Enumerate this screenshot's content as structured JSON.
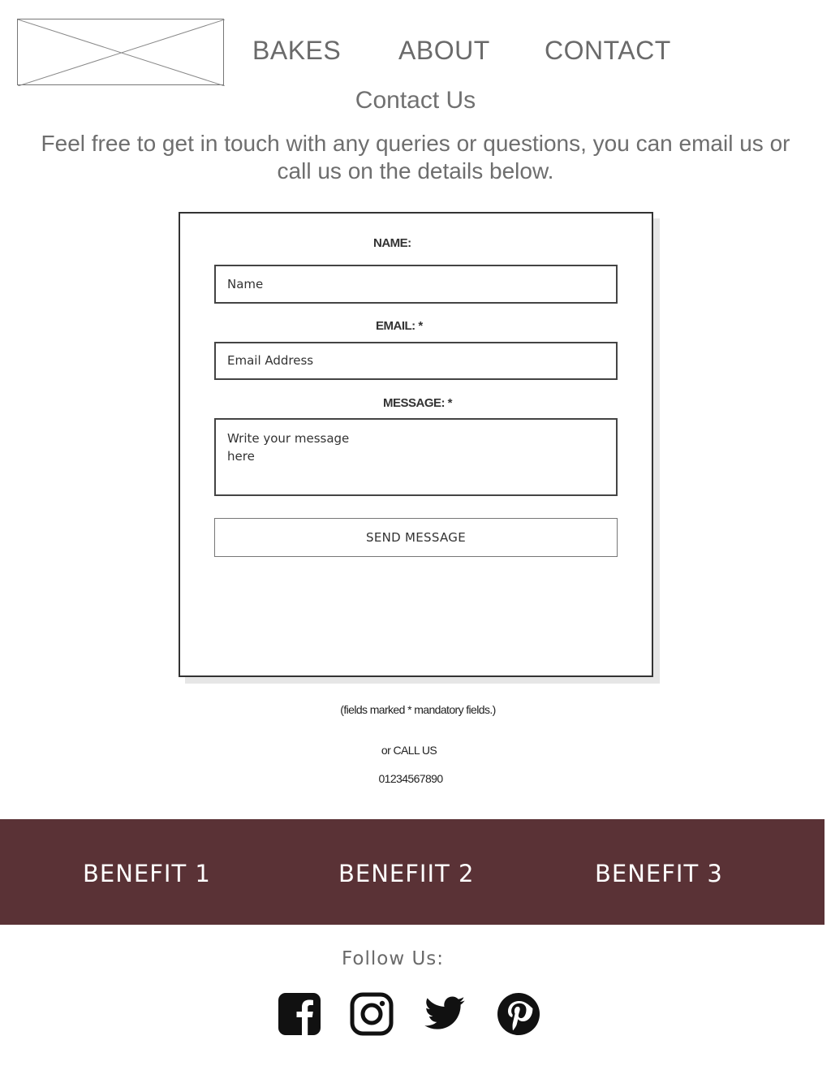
{
  "nav": {
    "bakes": "BAKES",
    "about": "ABOUT",
    "contact": "CONTACT"
  },
  "page": {
    "title": "Contact Us",
    "intro": "Feel free to get in touch with any queries or questions, you can email us or call us on the details below."
  },
  "form": {
    "name_label": "NAME:",
    "name_placeholder": "Name",
    "email_label": "EMAIL: *",
    "email_placeholder": "Email Address",
    "message_label": "MESSAGE: *",
    "message_placeholder": "Write your message\nhere",
    "submit_label": "SEND MESSAGE"
  },
  "notes": {
    "mandatory": "(fields marked * mandatory fields.)",
    "call_us": "or CALL US",
    "phone": "01234567890"
  },
  "benefits": [
    "BENEFIT 1",
    "BENEFIIT 2",
    "BENEFIT 3"
  ],
  "footer": {
    "follow_label": "Follow Us:",
    "social_icons": [
      "facebook-icon",
      "instagram-icon",
      "twitter-icon",
      "pinterest-icon"
    ]
  },
  "colors": {
    "benefits_bar": "#5a3236",
    "text_grey": "#6e6e6e"
  }
}
